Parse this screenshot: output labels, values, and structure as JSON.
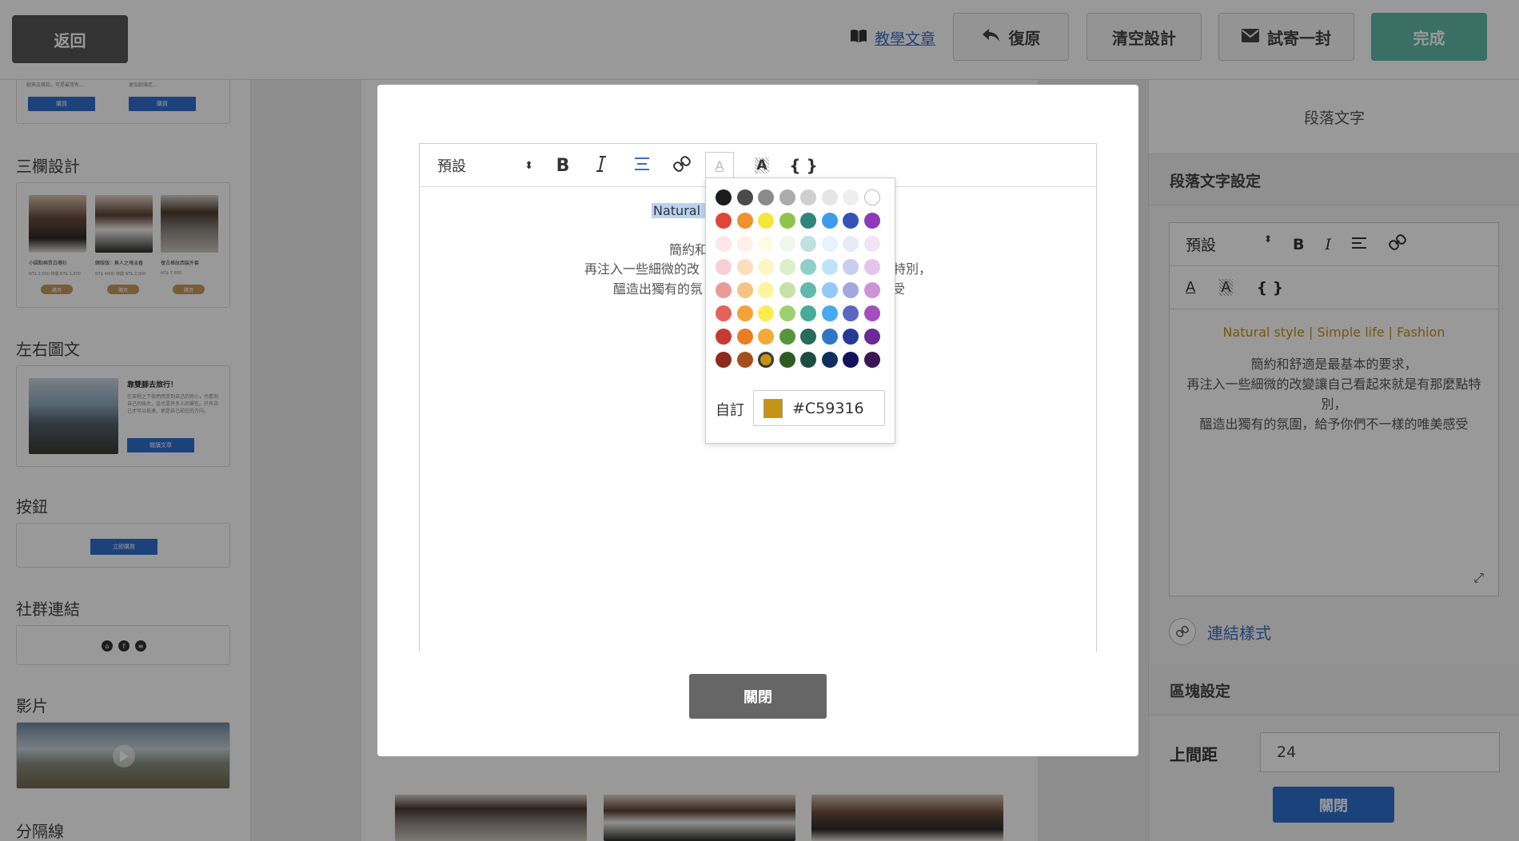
{
  "topbar": {
    "back": "返回",
    "tutorial": "教學文章",
    "undo": "復原",
    "clear": "清空設計",
    "send_test": "試寄一封",
    "done": "完成"
  },
  "sidebar": {
    "sections": {
      "three_col": "三欄設計",
      "left_right": "左右圖文",
      "button": "按鈕",
      "social": "社群連結",
      "video": "影片",
      "divider": "分隔線"
    },
    "top_card": {
      "text1": "經典這幾款，可是最常有…",
      "text2": "更加勁滿足…",
      "btn1": "購買",
      "btn2": "購買"
    },
    "three_col": {
      "items": [
        {
          "name": "小圓點棉質白襯衫",
          "price": "NT$ 2,000 特價 NT$ 1,000",
          "btn": "購買"
        },
        {
          "name": "韓版版：無人之境淡香",
          "price": "NT$ 4000 特價 NT$ 2,000",
          "btn": "購買"
        },
        {
          "name": "復古格紋西裝外套",
          "price": "NT$ 7,000",
          "btn": "購買"
        }
      ]
    },
    "left_right": {
      "title": "靠雙腳去旅行！",
      "body": "在旅程之下我們感受到自己的渺小，也看到自己的強大，這也是許多人的嚮往。只有自己才可以抵達，更是自己前往的方向。",
      "btn": "閱讀文章"
    },
    "button_demo": "立即購買",
    "social_icons": [
      "home-icon",
      "facebook-icon",
      "line-icon"
    ]
  },
  "right_panel": {
    "header": "段落文字",
    "section1": "段落文字設定",
    "toolbar": {
      "select": "預設",
      "bold": "B",
      "italic": "I",
      "var": "{ }"
    },
    "content": {
      "accent_line": "Natural style | Simple life | Fashion",
      "lines": [
        "簡約和舒適是最基本的要求，",
        "再注入一些細微的改變讓自己看起來就是有那麼點特別，",
        "醞造出獨有的氛圍，給予你們不一樣的唯美感受"
      ]
    },
    "link_style": "連結樣式",
    "section2": "區塊設定",
    "top_margin_label": "上間距",
    "top_margin_value": "24",
    "close": "關閉"
  },
  "modal": {
    "toolbar": {
      "select": "預設",
      "bold": "B",
      "italic": "I",
      "var": "{ }"
    },
    "content": {
      "selected_partial": "Natural s",
      "line1": "簡約和",
      "line2_left": "再注入一些細微的改",
      "line2_right": "特別，",
      "line3_left": "醞造出獨有的氛",
      "line3_right": "受"
    },
    "close": "關閉"
  },
  "color_picker": {
    "swatch_rows": [
      [
        "#1c1c1c",
        "#4a4a4a",
        "#8a8a8a",
        "#ababab",
        "#cfcfcf",
        "#e5e5e5",
        "#eeeeee",
        "#ffffff"
      ],
      [
        "#e0453a",
        "#f0902e",
        "#f6e53b",
        "#8ec44e",
        "#2f8577",
        "#3c9cea",
        "#3551b8",
        "#8c3ab8"
      ],
      [
        "#fce6ea",
        "#fff0e6",
        "#fffbe6",
        "#eef7e9",
        "#bfe1df",
        "#e4f3fc",
        "#e8ebf7",
        "#f2e4f3"
      ],
      [
        "#f7cfd3",
        "#fbdfbc",
        "#fff5c2",
        "#dcefcb",
        "#8fcfc9",
        "#bee3f8",
        "#c9cdee",
        "#e5c4ea"
      ],
      [
        "#ea9a98",
        "#f8c282",
        "#fff49b",
        "#c5e2a4",
        "#63b8ac",
        "#8ecbf5",
        "#a2a8de",
        "#cc93d9"
      ],
      [
        "#e3625b",
        "#f4a236",
        "#fdeb4f",
        "#9fd06d",
        "#4aaa9a",
        "#45aaf0",
        "#5a66c0",
        "#a54ebf"
      ],
      [
        "#c73a33",
        "#ec7b22",
        "#f3a937",
        "#56963c",
        "#2a6a5e",
        "#2f77c6",
        "#273998",
        "#6b2a9a"
      ],
      [
        "#8e2a1e",
        "#a44f1b",
        "#c59316",
        "#2f5a22",
        "#1d4d41",
        "#0f2f5e",
        "#12135c",
        "#3a1653"
      ]
    ],
    "selected_color": "#c59316",
    "custom_label": "自訂",
    "custom_value": "#C59316"
  }
}
